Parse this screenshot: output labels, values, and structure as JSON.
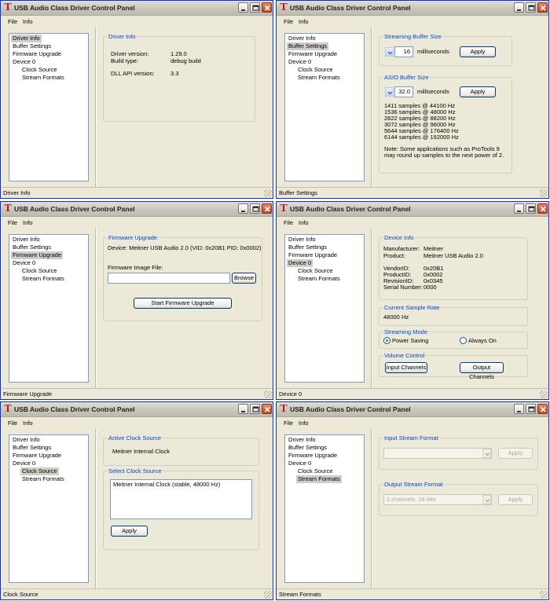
{
  "app_title": "USB Audio Class Driver Control Panel",
  "menu": {
    "file": "File",
    "info": "Info"
  },
  "tree": [
    "Driver Info",
    "Buffer Settings",
    "Firmware Upgrade",
    "Device 0",
    "Clock Source",
    "Stream Formats"
  ],
  "panels": [
    {
      "status": "Driver Info",
      "selected": 0,
      "group_title": "Driver Info",
      "rows": [
        {
          "label": "Driver version:",
          "value": "1.29.0"
        },
        {
          "label": "Build type:",
          "value": "debug build"
        },
        {
          "label": "DLL API version:",
          "value": "3.3"
        }
      ]
    },
    {
      "status": "Buffer Settings",
      "selected": 1,
      "streaming": {
        "title": "Streaming Buffer Size",
        "value": "16",
        "unit": "milliseconds",
        "apply": "Apply"
      },
      "asio": {
        "title": "ASIO Buffer Size",
        "value": "32.0",
        "unit": "milliseconds",
        "apply": "Apply",
        "samples": [
          "1411 samples @ 44100 Hz",
          "1536 samples @ 48000 Hz",
          "2822 samples @ 88200 Hz",
          "3072 samples @ 96000 Hz",
          "5644 samples @ 176400 Hz",
          "6144 samples @ 192000 Hz"
        ],
        "note_line1": "Note: Some applications such as ProTools 9",
        "note_line2": "may round up samples to the next power of 2."
      }
    },
    {
      "status": "Firmware Upgrade",
      "selected": 2,
      "group_title": "Firmware Upgrade",
      "device_line": "Device: Meitner USB Audio 2.0 (VID: 0x20B1 PID: 0x0002)",
      "image_label": "Firmware Image File:",
      "image_value": "",
      "browse": "Browse",
      "start": "Start Firmware Upgrade"
    },
    {
      "status": "Device 0",
      "selected": 3,
      "device_info": {
        "title": "Device Info",
        "rows": [
          {
            "label": "Manufacturer:",
            "value": "Meitner"
          },
          {
            "label": "Product:",
            "value": "Meitner USB Audio 2.0"
          },
          {
            "label": "VendorID:",
            "value": "0x20B1"
          },
          {
            "label": "ProductID:",
            "value": "0x0002"
          },
          {
            "label": "RevisionID:",
            "value": "0x0345"
          },
          {
            "label": "Serial Number:",
            "value": "0000"
          }
        ]
      },
      "sample_rate": {
        "title": "Current Sample Rate",
        "value": "48000 Hz"
      },
      "streaming_mode": {
        "title": "Streaming Mode",
        "option1": "Power Saving",
        "option2": "Always On",
        "selected": "Power Saving"
      },
      "volume": {
        "title": "Volume Control",
        "input": "Input Channels",
        "output": "Output Channels"
      }
    },
    {
      "status": "Clock Source",
      "selected": 4,
      "active": {
        "title": "Active Clock Source",
        "value": "Meitner Internal Clock"
      },
      "select": {
        "title": "Select Clock Source",
        "items": [
          "Meitner Internal Clock (stable, 48000 Hz)"
        ],
        "apply": "Apply"
      }
    },
    {
      "status": "Stream Formats",
      "selected": 5,
      "input": {
        "title": "Input Stream Format",
        "value": "",
        "apply": "Apply"
      },
      "output": {
        "title": "Output Stream Format",
        "value": "2 channels, 24 bits",
        "apply": "Apply"
      }
    }
  ]
}
